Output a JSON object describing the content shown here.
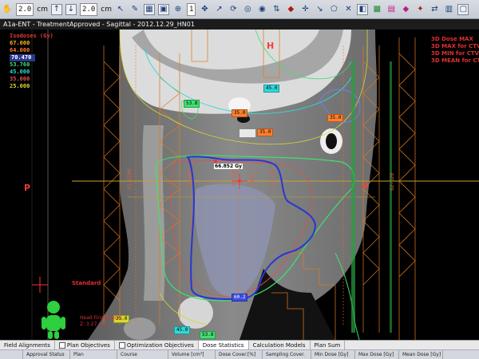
{
  "toolbar": {
    "value1": "2.0",
    "unit1": "cm",
    "value2": "2.0",
    "unit2": "cm",
    "page": "1"
  },
  "title": "A1a-ENT - TreatmentApproved - Sagittal - 2012.12.29_HN01",
  "legend": {
    "header": "Isodoses (Gy)",
    "levels": [
      {
        "value": "67.000",
        "color": "#ffb020"
      },
      {
        "value": "64.000",
        "color": "#ff7a30"
      },
      {
        "value": "70.470",
        "color": "#ffffff",
        "selected": true
      },
      {
        "value": "53.760",
        "color": "#40e070"
      },
      {
        "value": "45.000",
        "color": "#30d8d8"
      },
      {
        "value": "35.000",
        "color": "#e05050"
      },
      {
        "value": "25.000",
        "color": "#d8d830"
      }
    ]
  },
  "right_info": [
    "3D Dose MAX",
    "3D MAX for CTV",
    "3D MIN for CTV",
    "3D MEAN for CTV"
  ],
  "orientation": {
    "top": "H",
    "left": "P",
    "right": "A"
  },
  "dose_labels": [
    {
      "text": "45.0",
      "color": "#30d8d8"
    },
    {
      "text": "53.8",
      "color": "#40e070"
    },
    {
      "text": "35.0",
      "color": "#ff8030"
    },
    {
      "text": "35.0",
      "color": "#ff8030"
    },
    {
      "text": "35.0",
      "color": "#ff8030"
    },
    {
      "text": "60.2",
      "color": "#3a4ce0"
    },
    {
      "text": "25.0",
      "color": "#d8d830"
    },
    {
      "text": "45.0",
      "color": "#30d8d8"
    },
    {
      "text": "53.8",
      "color": "#40e070"
    }
  ],
  "point_label": "66.852 Gy",
  "vertical_labels": [
    "G1-G200",
    "P2-G40",
    "P2-G20",
    "BEAM",
    "G1-C40",
    "G2-G20"
  ],
  "standard_label": "Standard",
  "head_info": [
    "Head First-Supine",
    "Z: 3.27 cm"
  ],
  "tabs": [
    {
      "label": "Field Alignments",
      "checkbox": false
    },
    {
      "label": "Plan Objectives",
      "checkbox": true
    },
    {
      "label": "Optimization Objectives",
      "checkbox": true
    },
    {
      "label": "Dose Statistics",
      "checkbox": false
    },
    {
      "label": "Calculation Models",
      "checkbox": false
    },
    {
      "label": "Plan Sum",
      "checkbox": false
    }
  ],
  "columns": [
    "",
    "Approval Status",
    "Plan",
    "Course",
    "Volume [cm³]",
    "Dose Cover.[%]",
    "Sampling Cover.",
    "Min Dose [Gy]",
    "Max Dose [Gy]",
    "Mean Dose [Gy]"
  ]
}
